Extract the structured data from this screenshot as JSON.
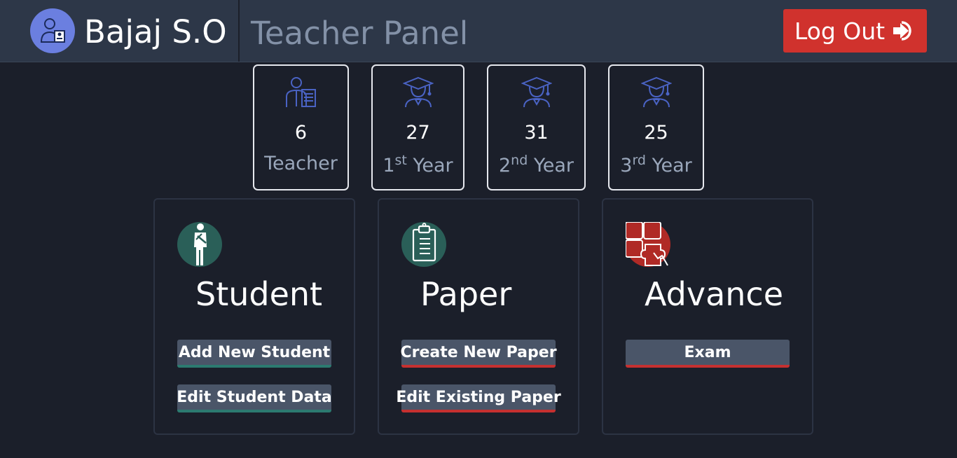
{
  "header": {
    "brand_name": "Bajaj S.O",
    "panel_title": "Teacher Panel",
    "logout_label": "Log Out"
  },
  "stats": [
    {
      "count": "6",
      "label": "Teacher",
      "icon": "teacher-icon"
    },
    {
      "count": "27",
      "label_num": "1",
      "label_sup": "st",
      "label_rest": " Year",
      "icon": "graduate-icon"
    },
    {
      "count": "31",
      "label_num": "2",
      "label_sup": "nd",
      "label_rest": " Year",
      "icon": "graduate-icon"
    },
    {
      "count": "25",
      "label_num": "3",
      "label_sup": "rd",
      "label_rest": " Year",
      "icon": "graduate-icon"
    }
  ],
  "cards": {
    "student": {
      "title": "Student",
      "icon": "student-icon",
      "buttons": [
        "Add New Student",
        "Edit Student Data"
      ]
    },
    "paper": {
      "title": "Paper",
      "icon": "clipboard-icon",
      "buttons": [
        "Create New Paper",
        "Edit Existing Paper"
      ]
    },
    "advance": {
      "title": "Advance",
      "icon": "puzzle-icon",
      "buttons": [
        "Exam"
      ]
    }
  },
  "colors": {
    "background": "#1b1f2a",
    "topbar": "#2d3748",
    "logout": "#d0322d",
    "button": "#4a5568",
    "teal_accent": "#2c7a70",
    "red_accent": "#c53030",
    "icon_blue": "#4a63c4"
  }
}
